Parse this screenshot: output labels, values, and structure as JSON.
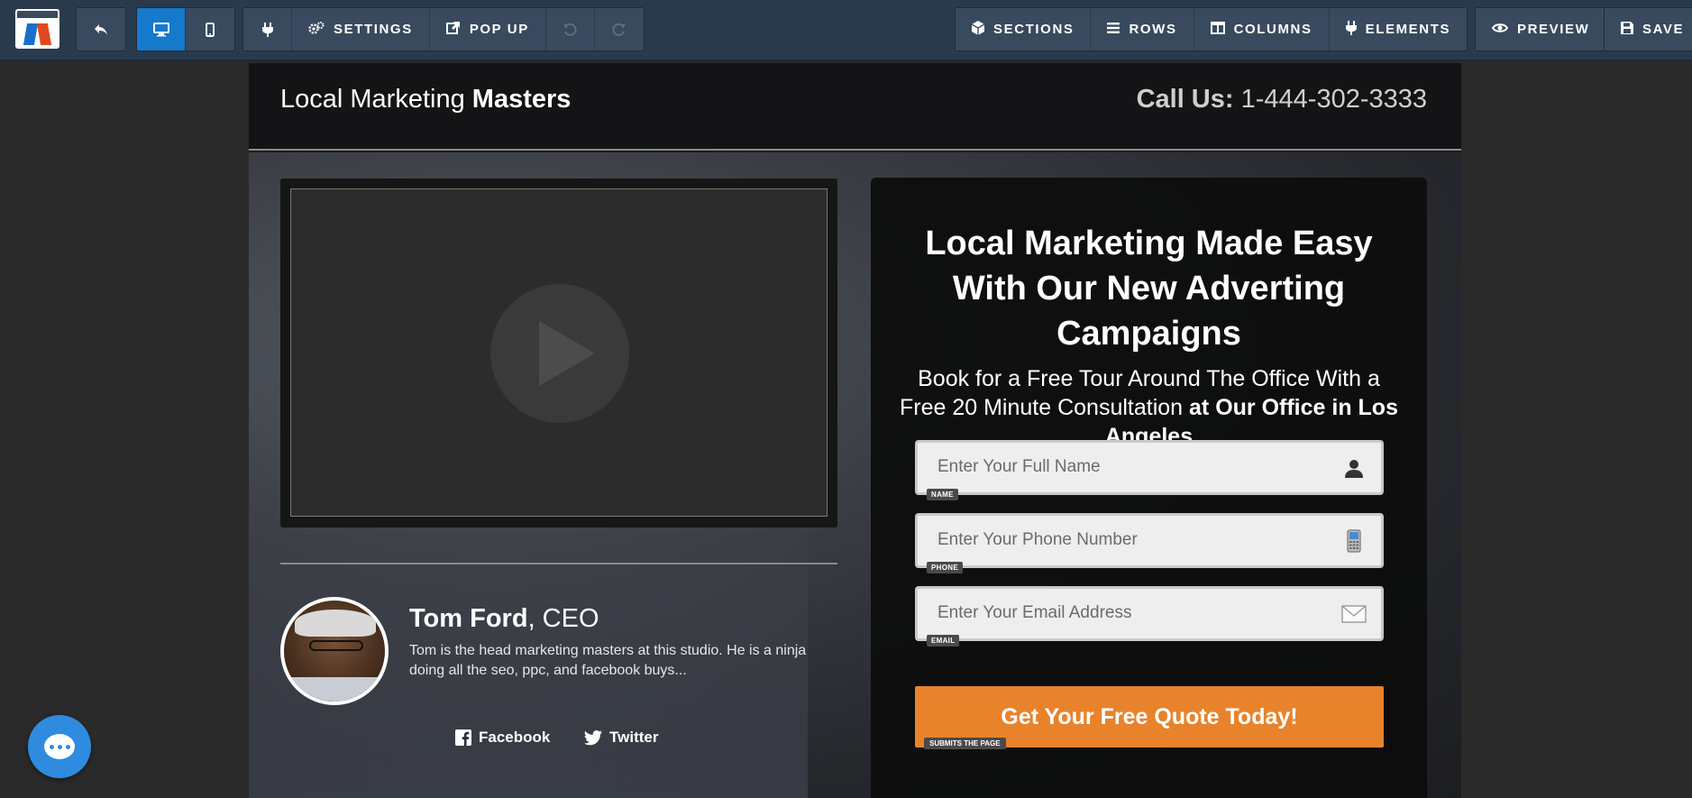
{
  "toolbar": {
    "settings_label": "SETTINGS",
    "popup_label": "POP UP",
    "sections_label": "SECTIONS",
    "rows_label": "ROWS",
    "columns_label": "COLUMNS",
    "elements_label": "ELEMENTS",
    "preview_label": "PREVIEW",
    "save_label": "SAVE",
    "active_view": "desktop",
    "accent_color": "#1579cc"
  },
  "header": {
    "brand_light": "Local Marketing",
    "brand_bold": "Masters",
    "call_label": "Call Us:",
    "phone": "1-444-302-3333"
  },
  "profile": {
    "name": "Tom Ford",
    "role": ", CEO",
    "bio": "Tom is the head marketing masters at this studio. He is a ninja doing all the seo, ppc, and facebook buys...",
    "facebook_label": "Facebook",
    "twitter_label": "Twitter"
  },
  "form": {
    "title": "Local Marketing Made Easy With Our New Adverting Campaigns",
    "subtitle_plain": "Book for a Free Tour Around The Office With a Free 20 Minute Consultation",
    "subtitle_bold": "at Our Office in Los Angeles",
    "name_placeholder": "Enter Your Full Name",
    "name_tag": "NAME",
    "phone_placeholder": "Enter Your Phone Number",
    "phone_tag": "PHONE",
    "email_placeholder": "Enter Your Email Address",
    "email_tag": "EMAIL",
    "cta_label": "Get Your Free Quote Today!",
    "cta_tag": "SUBMITS THE PAGE",
    "cta_color": "#e8832c"
  }
}
